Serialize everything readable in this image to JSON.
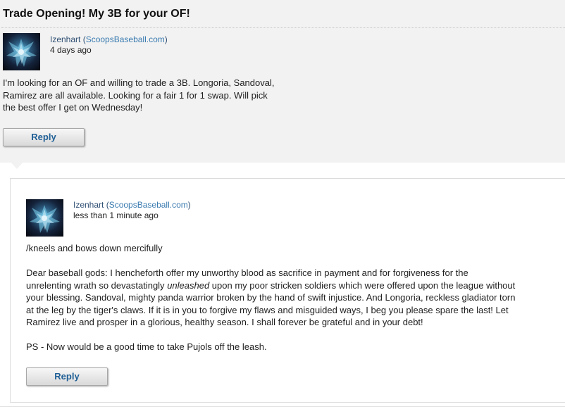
{
  "thread": {
    "title": "Trade Opening! My 3B for your OF!",
    "post": {
      "author": "Izenhart",
      "site": "ScoopsBaseball.com",
      "time": "4 days ago",
      "body_lines": [
        "I'm looking for an OF and willing to trade a 3B. Longoria, Sandoval,",
        "Ramirez are all available. Looking for a fair 1 for 1 swap. Will pick",
        "the best offer I get on Wednesday!"
      ],
      "reply_label": "Reply"
    }
  },
  "reply": {
    "author": "Izenhart",
    "site": "ScoopsBaseball.com",
    "time": "less than 1 minute ago",
    "line1": "/kneels and bows down mercifully",
    "para2_line1": "Dear baseball gods: I hencheforth offer my unworthy blood as sacrifice in payment and for forgiveness for the",
    "para2_line2_pre": "unrelenting wrath so devastatingly ",
    "para2_line2_em": "unleashed",
    "para2_line2_post": " upon my poor stricken soldiers which were offered upon the league without",
    "para2_line3": "your blessing. Sandoval, mighty panda warrior broken by the hand of swift injustice. And Longoria, reckless gladiator torn",
    "para2_line4": "at the leg by the tiger's claws. If it is in you to forgive my flaws and misguided ways, I beg you please spare the last! Let",
    "para2_line5": "Ramirez live and prosper in a glorious, healthy season. I shall forever be grateful and in your debt!",
    "ps": "PS - Now would be a good time to take Pujols off the leash.",
    "reply_label": "Reply"
  }
}
